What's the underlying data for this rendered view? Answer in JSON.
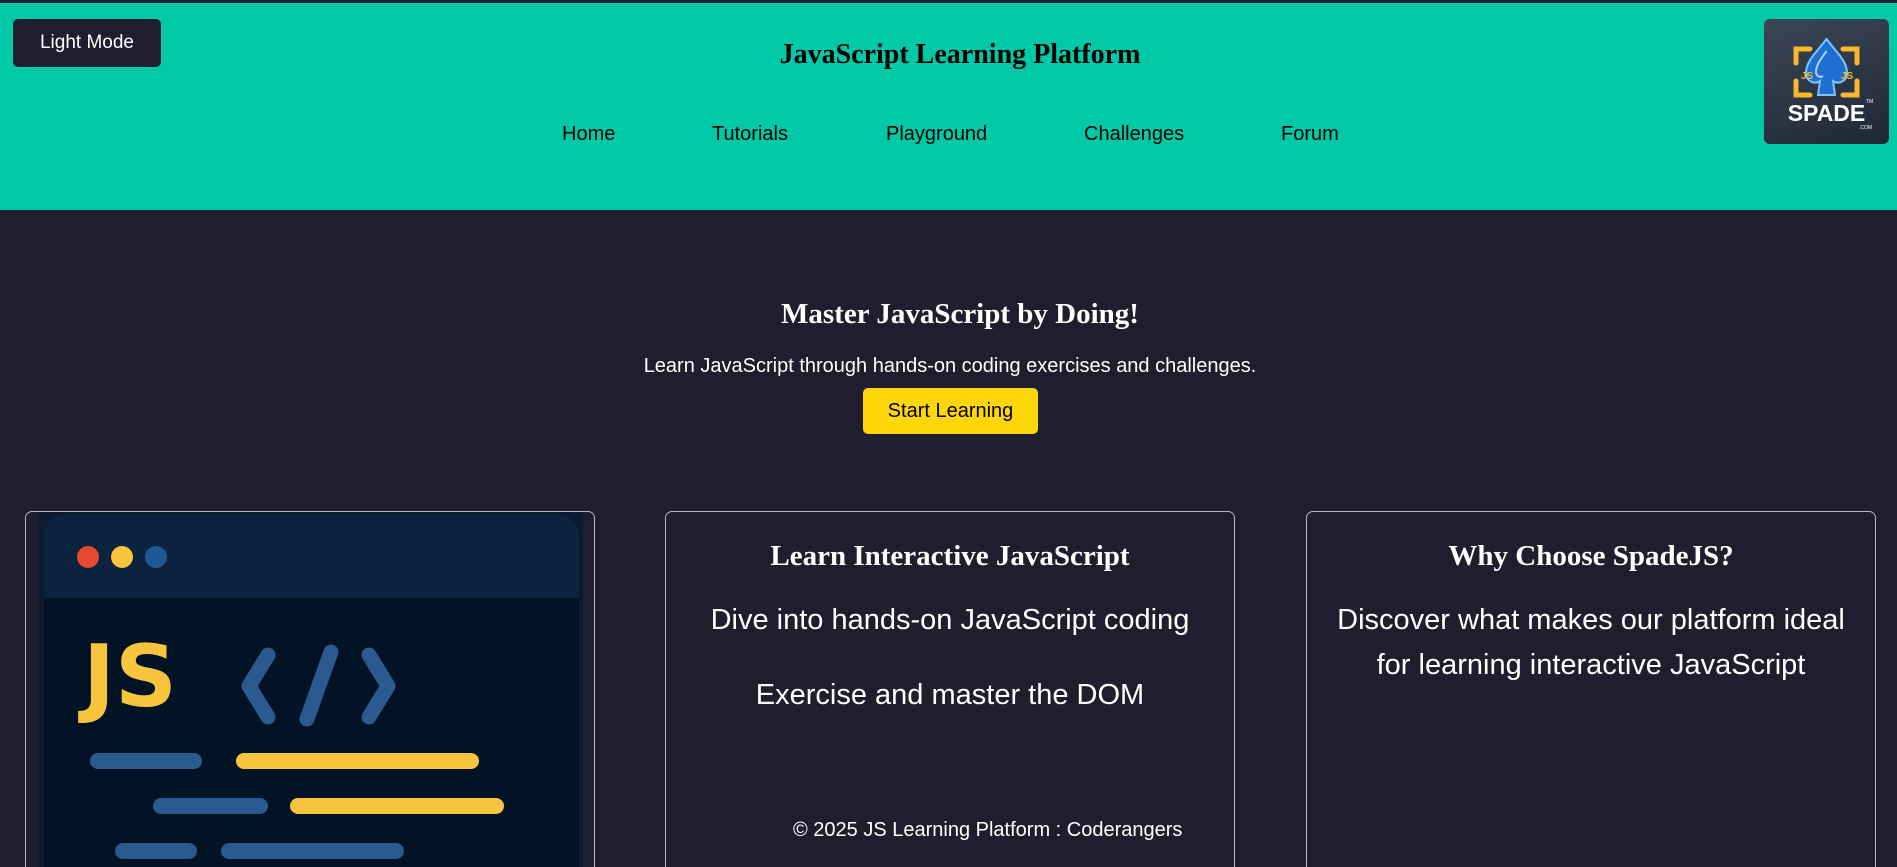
{
  "header": {
    "mode_toggle_label": "Light Mode",
    "title": "JavaScript Learning Platform",
    "nav": [
      "Home",
      "Tutorials",
      "Playground",
      "Challenges",
      "Forum"
    ],
    "logo": {
      "text": "SPADE",
      "small_text": "JS",
      "tm": "TM",
      "suffix": ".COM",
      "icon": "spade-shield-logo"
    }
  },
  "hero": {
    "title": "Master JavaScript by Doing!",
    "subtitle": "Learn JavaScript through hands-on coding exercises and challenges.",
    "cta_label": "Start Learning"
  },
  "illustration": {
    "icon": "code-editor-illustration",
    "label": "JS",
    "code_symbol": "</>"
  },
  "cards": {
    "learn": {
      "title": "Learn Interactive JavaScript",
      "line1": "Dive into hands-on JavaScript coding",
      "line2": "Exercise and master the DOM"
    },
    "why": {
      "title": "Why Choose SpadeJS?",
      "text": "Discover what makes our platform ideal for learning interactive JavaScript"
    }
  },
  "footer": {
    "text": "© 2025 JS Learning Platform : Coderangers"
  },
  "colors": {
    "header_bg": "#00c9a7",
    "page_bg": "#1e1e2e",
    "accent_yellow": "#ffd60a",
    "js_yellow": "#f7c53d",
    "code_blue": "#2a5a8f"
  }
}
